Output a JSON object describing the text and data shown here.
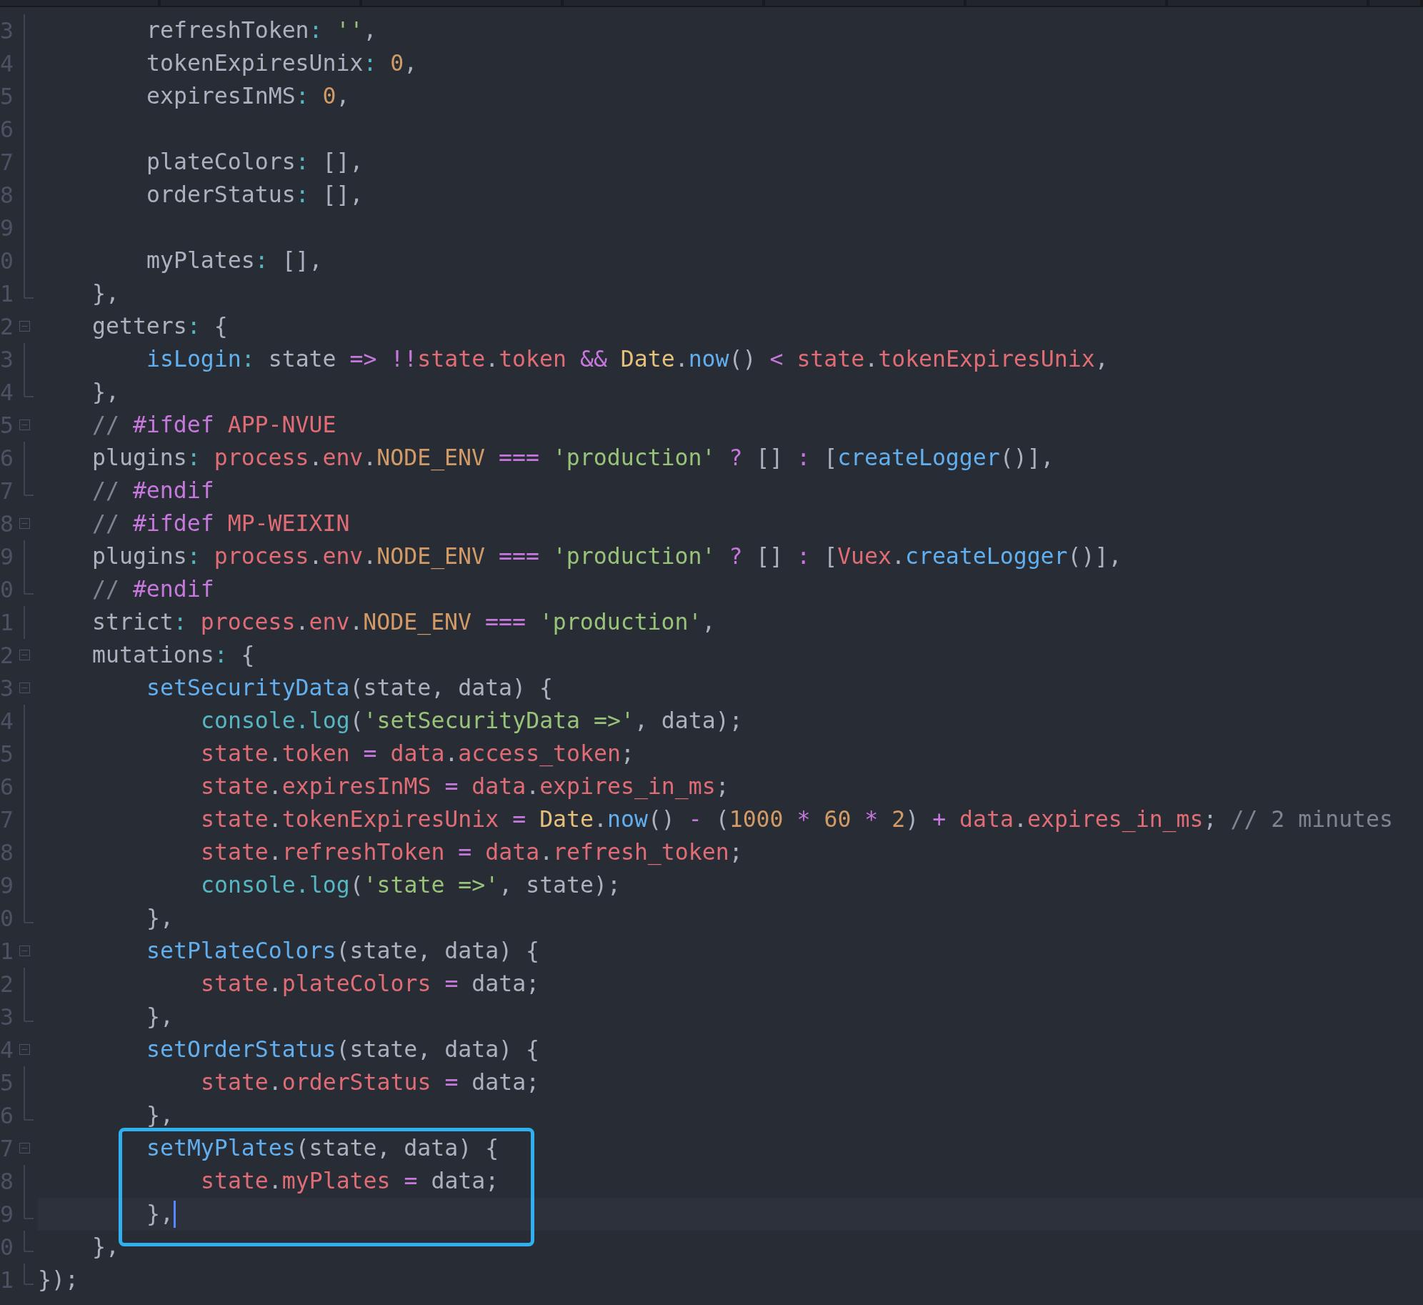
{
  "editor": {
    "lines": [
      {
        "number": "3",
        "kind": "plain",
        "current": false,
        "framed": false,
        "code": [
          {
            "kind": "plain",
            "text": "        refreshToken"
          },
          {
            "kind": "punct",
            "text": ":"
          },
          {
            "kind": "string",
            "text": " ''"
          },
          {
            "kind": "plain",
            "text": ","
          }
        ]
      },
      {
        "number": "4",
        "kind": "plain",
        "current": false,
        "framed": false,
        "code": [
          {
            "kind": "plain",
            "text": "        tokenExpiresUnix"
          },
          {
            "kind": "punct",
            "text": ":"
          },
          {
            "kind": "number",
            "text": " 0"
          },
          {
            "kind": "plain",
            "text": ","
          }
        ]
      },
      {
        "number": "5",
        "kind": "plain",
        "current": false,
        "framed": false,
        "code": [
          {
            "kind": "plain",
            "text": "        expiresInMS"
          },
          {
            "kind": "punct",
            "text": ":"
          },
          {
            "kind": "number",
            "text": " 0"
          },
          {
            "kind": "plain",
            "text": ","
          }
        ]
      },
      {
        "number": "6",
        "kind": "plain",
        "current": false,
        "framed": false
      },
      {
        "number": "7",
        "kind": "plain",
        "current": false,
        "framed": false,
        "code": [
          {
            "kind": "plain",
            "text": "        plateColors"
          },
          {
            "kind": "punct",
            "text": ":"
          },
          {
            "kind": "plain",
            "text": " [],"
          }
        ]
      },
      {
        "number": "8",
        "kind": "plain",
        "current": false,
        "framed": false,
        "code": [
          {
            "kind": "plain",
            "text": "        orderStatus"
          },
          {
            "kind": "punct",
            "text": ":"
          },
          {
            "kind": "plain",
            "text": " [],"
          }
        ]
      },
      {
        "number": "9",
        "kind": "plain",
        "current": false,
        "framed": false
      },
      {
        "number": "0",
        "kind": "plain",
        "current": false,
        "framed": false,
        "code": [
          {
            "kind": "plain",
            "text": "        myPlates"
          },
          {
            "kind": "punct",
            "text": ":"
          },
          {
            "kind": "plain",
            "text": " [],"
          }
        ]
      },
      {
        "number": "1",
        "kind": "fold-end",
        "current": false,
        "framed": false,
        "code": [
          {
            "kind": "plain",
            "text": "    },"
          }
        ]
      },
      {
        "number": "2",
        "kind": "fold-start",
        "current": false,
        "framed": false,
        "code": [
          {
            "kind": "plain",
            "text": "    getters"
          },
          {
            "kind": "punct",
            "text": ":"
          },
          {
            "kind": "plain",
            "text": " {"
          }
        ]
      },
      {
        "number": "3",
        "kind": "plain",
        "current": false,
        "framed": false,
        "code": [
          {
            "kind": "function",
            "text": "        isLogin"
          },
          {
            "kind": "punct",
            "text": ":"
          },
          {
            "kind": "plain",
            "text": " state "
          },
          {
            "kind": "operator",
            "text": "=> !!"
          },
          {
            "kind": "variable",
            "text": "state"
          },
          {
            "kind": "plain",
            "text": "."
          },
          {
            "kind": "variable",
            "text": "token "
          },
          {
            "kind": "operator",
            "text": "&&"
          },
          {
            "kind": "builtin",
            "text": " Date"
          },
          {
            "kind": "plain",
            "text": "."
          },
          {
            "kind": "function",
            "text": "now"
          },
          {
            "kind": "plain",
            "text": "() "
          },
          {
            "kind": "operator",
            "text": "<"
          },
          {
            "kind": "variable",
            "text": " state"
          },
          {
            "kind": "plain",
            "text": "."
          },
          {
            "kind": "variable",
            "text": "tokenExpiresUnix"
          },
          {
            "kind": "plain",
            "text": ","
          }
        ]
      },
      {
        "number": "4",
        "kind": "fold-end",
        "current": false,
        "framed": false,
        "code": [
          {
            "kind": "plain",
            "text": "    },"
          }
        ]
      },
      {
        "number": "5",
        "kind": "fold-start",
        "current": false,
        "framed": false,
        "code": [
          {
            "kind": "comment",
            "text": "    // "
          },
          {
            "kind": "operator",
            "text": "#ifdef "
          },
          {
            "kind": "variable",
            "text": "APP-NVUE"
          }
        ]
      },
      {
        "number": "6",
        "kind": "plain",
        "current": false,
        "framed": false,
        "code": [
          {
            "kind": "plain",
            "text": "    plugins"
          },
          {
            "kind": "punct",
            "text": ":"
          },
          {
            "kind": "variable",
            "text": " process"
          },
          {
            "kind": "plain",
            "text": "."
          },
          {
            "kind": "variable",
            "text": "env"
          },
          {
            "kind": "plain",
            "text": "."
          },
          {
            "kind": "number",
            "text": "NODE_ENV "
          },
          {
            "kind": "operator",
            "text": "==="
          },
          {
            "kind": "string",
            "text": " 'production'"
          },
          {
            "kind": "operator",
            "text": " ?"
          },
          {
            "kind": "plain",
            "text": " [] "
          },
          {
            "kind": "operator",
            "text": ":"
          },
          {
            "kind": "plain",
            "text": " ["
          },
          {
            "kind": "function",
            "text": "createLogger"
          },
          {
            "kind": "plain",
            "text": "()],"
          }
        ]
      },
      {
        "number": "7",
        "kind": "fold-end",
        "current": false,
        "framed": false,
        "code": [
          {
            "kind": "comment",
            "text": "    // "
          },
          {
            "kind": "operator",
            "text": "#endif"
          }
        ]
      },
      {
        "number": "8",
        "kind": "fold-start",
        "current": false,
        "framed": false,
        "code": [
          {
            "kind": "comment",
            "text": "    // "
          },
          {
            "kind": "operator",
            "text": "#ifdef "
          },
          {
            "kind": "variable",
            "text": "MP-WEIXIN"
          }
        ]
      },
      {
        "number": "9",
        "kind": "plain",
        "current": false,
        "framed": false,
        "code": [
          {
            "kind": "plain",
            "text": "    plugins"
          },
          {
            "kind": "punct",
            "text": ":"
          },
          {
            "kind": "variable",
            "text": " process"
          },
          {
            "kind": "plain",
            "text": "."
          },
          {
            "kind": "variable",
            "text": "env"
          },
          {
            "kind": "plain",
            "text": "."
          },
          {
            "kind": "number",
            "text": "NODE_ENV "
          },
          {
            "kind": "operator",
            "text": "==="
          },
          {
            "kind": "string",
            "text": " 'production'"
          },
          {
            "kind": "operator",
            "text": " ?"
          },
          {
            "kind": "plain",
            "text": " [] "
          },
          {
            "kind": "operator",
            "text": ":"
          },
          {
            "kind": "plain",
            "text": " ["
          },
          {
            "kind": "variable",
            "text": "Vuex"
          },
          {
            "kind": "plain",
            "text": "."
          },
          {
            "kind": "function",
            "text": "createLogger"
          },
          {
            "kind": "plain",
            "text": "()],"
          }
        ]
      },
      {
        "number": "0",
        "kind": "fold-end",
        "current": false,
        "framed": false,
        "code": [
          {
            "kind": "comment",
            "text": "    // "
          },
          {
            "kind": "operator",
            "text": "#endif"
          }
        ]
      },
      {
        "number": "1",
        "kind": "plain",
        "current": false,
        "framed": false,
        "code": [
          {
            "kind": "plain",
            "text": "    strict"
          },
          {
            "kind": "punct",
            "text": ":"
          },
          {
            "kind": "variable",
            "text": " process"
          },
          {
            "kind": "plain",
            "text": "."
          },
          {
            "kind": "variable",
            "text": "env"
          },
          {
            "kind": "plain",
            "text": "."
          },
          {
            "kind": "number",
            "text": "NODE_ENV "
          },
          {
            "kind": "operator",
            "text": "==="
          },
          {
            "kind": "string",
            "text": " 'production'"
          },
          {
            "kind": "plain",
            "text": ","
          }
        ]
      },
      {
        "number": "2",
        "kind": "fold-start",
        "current": false,
        "framed": false,
        "code": [
          {
            "kind": "plain",
            "text": "    mutations"
          },
          {
            "kind": "punct",
            "text": ":"
          },
          {
            "kind": "plain",
            "text": " {"
          }
        ]
      },
      {
        "number": "3",
        "kind": "fold-start",
        "current": false,
        "framed": false,
        "code": [
          {
            "kind": "function",
            "text": "        setSecurityData"
          },
          {
            "kind": "plain",
            "text": "(state, data) {"
          }
        ]
      },
      {
        "number": "4",
        "kind": "plain",
        "current": false,
        "framed": false,
        "code": [
          {
            "kind": "method",
            "text": "            console.log"
          },
          {
            "kind": "plain",
            "text": "("
          },
          {
            "kind": "string",
            "text": "'setSecurityData =>'"
          },
          {
            "kind": "plain",
            "text": ", data);"
          }
        ]
      },
      {
        "number": "5",
        "kind": "plain",
        "current": false,
        "framed": false,
        "code": [
          {
            "kind": "variable",
            "text": "            state"
          },
          {
            "kind": "plain",
            "text": "."
          },
          {
            "kind": "variable",
            "text": "token "
          },
          {
            "kind": "operator",
            "text": "="
          },
          {
            "kind": "variable",
            "text": " data"
          },
          {
            "kind": "plain",
            "text": "."
          },
          {
            "kind": "variable",
            "text": "access_token"
          },
          {
            "kind": "plain",
            "text": ";"
          }
        ]
      },
      {
        "number": "6",
        "kind": "plain",
        "current": false,
        "framed": false,
        "code": [
          {
            "kind": "variable",
            "text": "            state"
          },
          {
            "kind": "plain",
            "text": "."
          },
          {
            "kind": "variable",
            "text": "expiresInMS "
          },
          {
            "kind": "operator",
            "text": "="
          },
          {
            "kind": "variable",
            "text": " data"
          },
          {
            "kind": "plain",
            "text": "."
          },
          {
            "kind": "variable",
            "text": "expires_in_ms"
          },
          {
            "kind": "plain",
            "text": ";"
          }
        ]
      },
      {
        "number": "7",
        "kind": "plain",
        "current": false,
        "framed": false,
        "code": [
          {
            "kind": "variable",
            "text": "            state"
          },
          {
            "kind": "plain",
            "text": "."
          },
          {
            "kind": "variable",
            "text": "tokenExpiresUnix "
          },
          {
            "kind": "operator",
            "text": "="
          },
          {
            "kind": "builtin",
            "text": " Date"
          },
          {
            "kind": "plain",
            "text": "."
          },
          {
            "kind": "function",
            "text": "now"
          },
          {
            "kind": "plain",
            "text": "() "
          },
          {
            "kind": "operator",
            "text": "-"
          },
          {
            "kind": "plain",
            "text": " ("
          },
          {
            "kind": "number",
            "text": "1000 "
          },
          {
            "kind": "operator",
            "text": "*"
          },
          {
            "kind": "number",
            "text": " 60 "
          },
          {
            "kind": "operator",
            "text": "*"
          },
          {
            "kind": "number",
            "text": " 2"
          },
          {
            "kind": "plain",
            "text": ") "
          },
          {
            "kind": "operator",
            "text": "+"
          },
          {
            "kind": "variable",
            "text": " data"
          },
          {
            "kind": "plain",
            "text": "."
          },
          {
            "kind": "variable",
            "text": "expires_in_ms"
          },
          {
            "kind": "plain",
            "text": "; "
          },
          {
            "kind": "comment",
            "text": "// 2 minutes"
          }
        ]
      },
      {
        "number": "8",
        "kind": "plain",
        "current": false,
        "framed": false,
        "code": [
          {
            "kind": "variable",
            "text": "            state"
          },
          {
            "kind": "plain",
            "text": "."
          },
          {
            "kind": "variable",
            "text": "refreshToken "
          },
          {
            "kind": "operator",
            "text": "="
          },
          {
            "kind": "variable",
            "text": " data"
          },
          {
            "kind": "plain",
            "text": "."
          },
          {
            "kind": "variable",
            "text": "refresh_token"
          },
          {
            "kind": "plain",
            "text": ";"
          }
        ]
      },
      {
        "number": "9",
        "kind": "plain",
        "current": false,
        "framed": false,
        "code": [
          {
            "kind": "method",
            "text": "            console.log"
          },
          {
            "kind": "plain",
            "text": "("
          },
          {
            "kind": "string",
            "text": "'state =>'"
          },
          {
            "kind": "plain",
            "text": ", state);"
          }
        ]
      },
      {
        "number": "0",
        "kind": "fold-end",
        "current": false,
        "framed": false,
        "code": [
          {
            "kind": "plain",
            "text": "        },"
          }
        ]
      },
      {
        "number": "1",
        "kind": "fold-start",
        "current": false,
        "framed": false,
        "code": [
          {
            "kind": "function",
            "text": "        setPlateColors"
          },
          {
            "kind": "plain",
            "text": "(state, data) {"
          }
        ]
      },
      {
        "number": "2",
        "kind": "plain",
        "current": false,
        "framed": false,
        "code": [
          {
            "kind": "variable",
            "text": "            state"
          },
          {
            "kind": "plain",
            "text": "."
          },
          {
            "kind": "variable",
            "text": "plateColors "
          },
          {
            "kind": "operator",
            "text": "="
          },
          {
            "kind": "plain",
            "text": " data;"
          }
        ]
      },
      {
        "number": "3",
        "kind": "fold-end",
        "current": false,
        "framed": false,
        "code": [
          {
            "kind": "plain",
            "text": "        },"
          }
        ]
      },
      {
        "number": "4",
        "kind": "fold-start",
        "current": false,
        "framed": false,
        "code": [
          {
            "kind": "function",
            "text": "        setOrderStatus"
          },
          {
            "kind": "plain",
            "text": "(state, data) {"
          }
        ]
      },
      {
        "number": "5",
        "kind": "plain",
        "current": false,
        "framed": false,
        "code": [
          {
            "kind": "variable",
            "text": "            state"
          },
          {
            "kind": "plain",
            "text": "."
          },
          {
            "kind": "variable",
            "text": "orderStatus "
          },
          {
            "kind": "operator",
            "text": "="
          },
          {
            "kind": "plain",
            "text": " data;"
          }
        ]
      },
      {
        "number": "6",
        "kind": "fold-end",
        "current": false,
        "framed": false,
        "code": [
          {
            "kind": "plain",
            "text": "        },"
          }
        ]
      },
      {
        "number": "7",
        "kind": "fold-start",
        "current": false,
        "framed": true,
        "code": [
          {
            "kind": "function",
            "text": "        setMyPlates"
          },
          {
            "kind": "plain",
            "text": "(state, data) {"
          }
        ]
      },
      {
        "number": "8",
        "kind": "plain",
        "current": false,
        "framed": true,
        "code": [
          {
            "kind": "variable",
            "text": "            state"
          },
          {
            "kind": "plain",
            "text": "."
          },
          {
            "kind": "variable",
            "text": "myPlates "
          },
          {
            "kind": "operator",
            "text": "="
          },
          {
            "kind": "plain",
            "text": " data;"
          }
        ]
      },
      {
        "number": "9",
        "kind": "fold-end",
        "current": true,
        "framed": true,
        "code": [
          {
            "kind": "plain",
            "text": "        },"
          }
        ]
      },
      {
        "number": "0",
        "kind": "fold-end",
        "current": false,
        "framed": false,
        "code": [
          {
            "kind": "plain",
            "text": "    },"
          }
        ]
      },
      {
        "number": "1",
        "kind": "fold-end",
        "current": false,
        "framed": false,
        "code": [
          {
            "kind": "plain",
            "text": "});"
          }
        ]
      }
    ]
  }
}
